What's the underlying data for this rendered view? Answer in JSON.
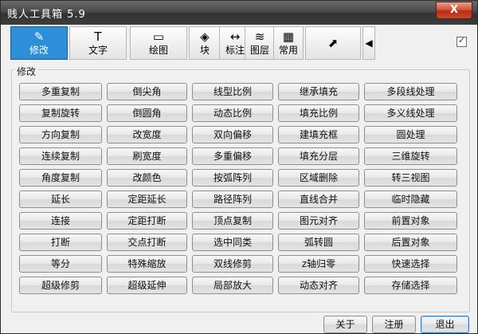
{
  "window": {
    "title": "贱人工具箱 5.9",
    "close_label": "X"
  },
  "toolbar": {
    "tabs": [
      {
        "id": "modify",
        "label": "修改",
        "icon": "pencil-icon",
        "glyph": "✎"
      },
      {
        "id": "text",
        "label": "文字",
        "icon": "text-t-icon",
        "glyph": "T"
      },
      {
        "id": "draw",
        "label": "绘图",
        "icon": "draw-shapes-icon",
        "glyph": "▭"
      },
      {
        "id": "block",
        "label": "块",
        "icon": "block-icon",
        "glyph": "◈"
      },
      {
        "id": "dimension",
        "label": "标注",
        "icon": "dimension-icon",
        "glyph": "↔"
      },
      {
        "id": "layer",
        "label": "图层",
        "icon": "layers-icon",
        "glyph": "≋"
      },
      {
        "id": "common",
        "label": "常用",
        "icon": "grid-colors-icon",
        "glyph": "▦"
      }
    ],
    "expand_glyph": "⬈",
    "arrow_glyph": "◀",
    "checkbox_checked": true
  },
  "group": {
    "title": "修改"
  },
  "grid": [
    [
      "多重复制",
      "倒尖角",
      "线型比例",
      "继承填充",
      "多段线处理"
    ],
    [
      "复制旋转",
      "倒圆角",
      "动态比例",
      "填充比例",
      "多义线处理"
    ],
    [
      "方向复制",
      "改宽度",
      "双向偏移",
      "建填充框",
      "圆处理"
    ],
    [
      "连续复制",
      "刷宽度",
      "多重偏移",
      "填充分层",
      "三维旋转"
    ],
    [
      "角度复制",
      "改颜色",
      "按弧阵列",
      "区域删除",
      "转三视图"
    ],
    [
      "延长",
      "定距延长",
      "路径阵列",
      "直线合并",
      "临时隐藏"
    ],
    [
      "连接",
      "定距打断",
      "顶点复制",
      "图元对齐",
      "前置对象"
    ],
    [
      "打断",
      "交点打断",
      "选中同类",
      "弧转圆",
      "后置对象"
    ],
    [
      "等分",
      "特殊缩放",
      "双线修剪",
      "z轴归零",
      "快速选择"
    ],
    [
      "超级修剪",
      "超级延伸",
      "局部放大",
      "动态对齐",
      "存储选择"
    ]
  ],
  "footer": {
    "about": "关于",
    "register": "注册",
    "exit": "退出"
  }
}
